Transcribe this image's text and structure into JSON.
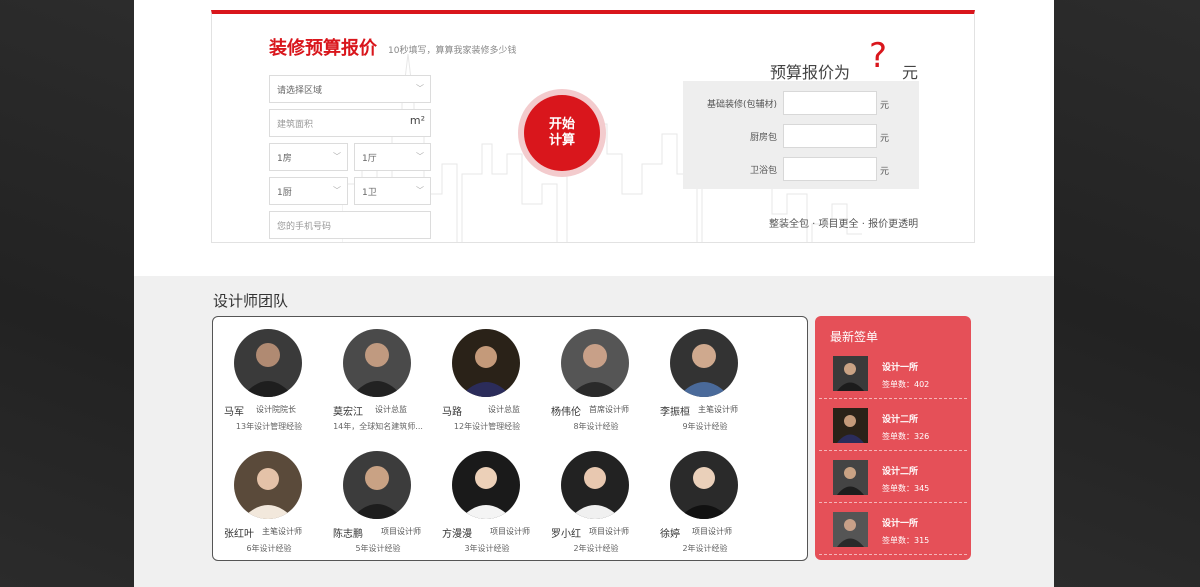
{
  "calculator": {
    "title": "装修预算报价",
    "subtitle": "10秒填写，算算我家装修多少钱",
    "region_placeholder": "请选择区域",
    "area_placeholder": "建筑面积",
    "area_unit": "m²",
    "rooms_value": "1房",
    "halls_value": "1厅",
    "kitchens_value": "1厨",
    "baths_value": "1卫",
    "phone_placeholder": "您的手机号码",
    "start_button": [
      "开始",
      "计算"
    ],
    "result_title": "预算报价为",
    "result_value": "?",
    "result_unit": "元",
    "rows": [
      {
        "label": "基础装修(包辅材)",
        "unit": "元"
      },
      {
        "label": "厨房包",
        "unit": "元"
      },
      {
        "label": "卫浴包",
        "unit": "元"
      }
    ],
    "slogan": "整装全包 · 项目更全 · 报价更透明"
  },
  "team": {
    "title": "设计师团队",
    "members": [
      {
        "name": "马军",
        "role": "设计院院长",
        "exp": "13年设计管理经验"
      },
      {
        "name": "莫宏江",
        "role": "设计总监",
        "exp": "14年，全球知名建筑师..."
      },
      {
        "name": "马路",
        "role": "设计总监",
        "exp": "12年设计管理经验"
      },
      {
        "name": "杨伟伦",
        "role": "首席设计师",
        "exp": "8年设计经验"
      },
      {
        "name": "李振桓",
        "role": "主笔设计师",
        "exp": "9年设计经验"
      },
      {
        "name": "张红叶",
        "role": "主笔设计师",
        "exp": "6年设计经验"
      },
      {
        "name": "陈志鹏",
        "role": "项目设计师",
        "exp": "5年设计经验"
      },
      {
        "name": "方漫漫",
        "role": "项目设计师",
        "exp": "3年设计经验"
      },
      {
        "name": "罗小红",
        "role": "项目设计师",
        "exp": "2年设计经验"
      },
      {
        "name": "徐婷",
        "role": "项目设计师",
        "exp": "2年设计经验"
      }
    ]
  },
  "deals": {
    "title": "最新签单",
    "items": [
      {
        "name": "设计一所",
        "count": "签单数：402"
      },
      {
        "name": "设计二所",
        "count": "签单数：326"
      },
      {
        "name": "设计二所",
        "count": "签单数：345"
      },
      {
        "name": "设计一所",
        "count": "签单数：315"
      }
    ]
  },
  "colors": {
    "accent": "#d9161c",
    "deal_panel": "#e55058",
    "background_dark": "#262626"
  }
}
